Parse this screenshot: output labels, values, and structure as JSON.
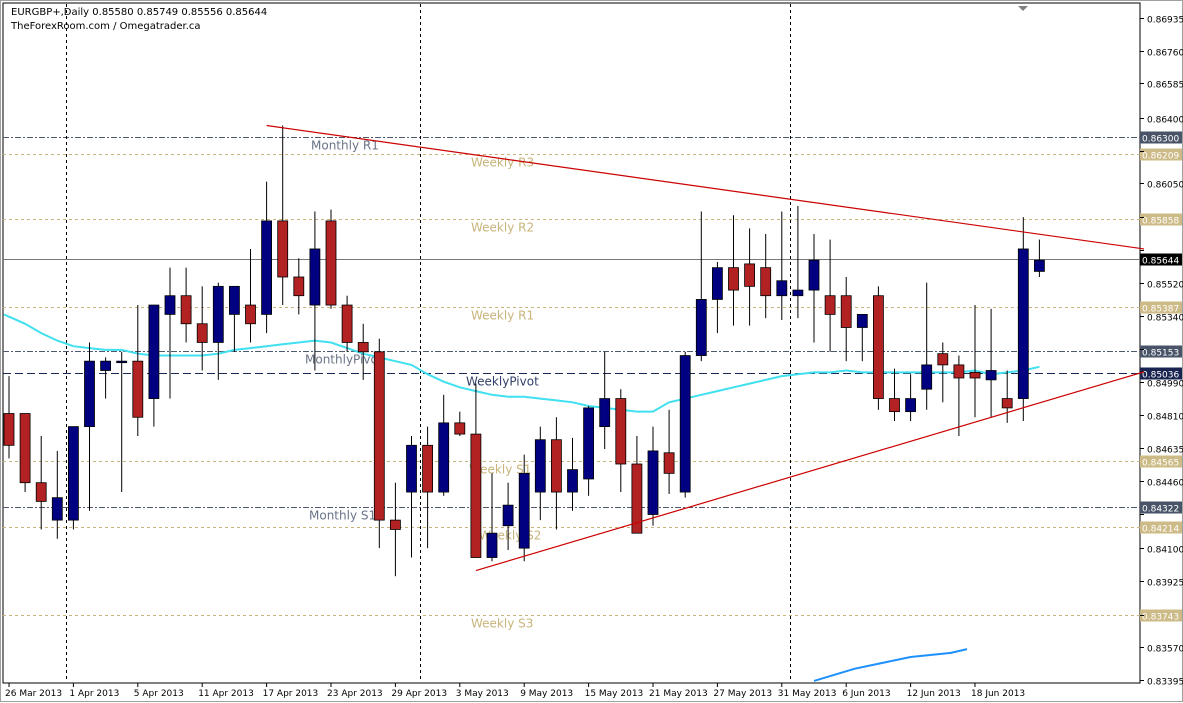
{
  "header": {
    "symbol_timeframe": "EURGBP+,Daily",
    "ohlc": "0.85580 0.85749 0.85556 0.85644",
    "credit": "TheForexRoom.com / Omegatrader.ca"
  },
  "colors": {
    "background": "#ffffff",
    "bull_candle": "#000080",
    "bear_candle": "#b22222",
    "moving_average": "#40e0f0",
    "trendline": "#cc0000",
    "lower_indicator": "#1e90ff",
    "monthly_level": "#505a6e",
    "weekly_level": "#c8b47a",
    "price_box": "#000000"
  },
  "chart_data": {
    "type": "candlestick",
    "symbol": "EURGBP+",
    "timeframe": "Daily",
    "ylim": [
      0.83395,
      0.86935
    ],
    "y_ticks": [
      "0.86935",
      "0.86760",
      "0.86585",
      "0.86400",
      "0.86225",
      "0.86050",
      "0.85870",
      "0.85695",
      "0.85520",
      "0.85340",
      "0.85165",
      "0.84990",
      "0.84810",
      "0.84635",
      "0.84460",
      "0.84280",
      "0.84100",
      "0.83925",
      "0.83745",
      "0.83570",
      "0.83395"
    ],
    "x_labels": [
      "26 Mar 2013",
      "1 Apr 2013",
      "5 Apr 2013",
      "11 Apr 2013",
      "17 Apr 2013",
      "23 Apr 2013",
      "29 Apr 2013",
      "3 May 2013",
      "9 May 2013",
      "15 May 2013",
      "21 May 2013",
      "27 May 2013",
      "31 May 2013",
      "6 Jun 2013",
      "12 Jun 2013",
      "18 Jun 2013"
    ],
    "x_label_bars": [
      0,
      4,
      8,
      12,
      16,
      20,
      24,
      28,
      32,
      36,
      40,
      44,
      48,
      52,
      56,
      60
    ],
    "period_separators_after_bars": [
      3,
      25,
      48
    ],
    "candles": [
      [
        0.8482,
        0.8502,
        0.8458,
        0.8465
      ],
      [
        0.8482,
        0.8482,
        0.844,
        0.8445
      ],
      [
        0.8445,
        0.847,
        0.842,
        0.8435
      ],
      [
        0.8425,
        0.8462,
        0.8415,
        0.8437
      ],
      [
        0.8425,
        0.8465,
        0.842,
        0.8475
      ],
      [
        0.8475,
        0.852,
        0.843,
        0.851
      ],
      [
        0.8505,
        0.8512,
        0.849,
        0.851
      ],
      [
        0.851,
        0.8515,
        0.844,
        0.851
      ],
      [
        0.851,
        0.854,
        0.847,
        0.848
      ],
      [
        0.849,
        0.8535,
        0.8475,
        0.854
      ],
      [
        0.8535,
        0.856,
        0.849,
        0.8545
      ],
      [
        0.8545,
        0.856,
        0.852,
        0.853
      ],
      [
        0.853,
        0.855,
        0.8505,
        0.852
      ],
      [
        0.852,
        0.8552,
        0.85,
        0.855
      ],
      [
        0.8535,
        0.8548,
        0.8515,
        0.855
      ],
      [
        0.854,
        0.857,
        0.852,
        0.853
      ],
      [
        0.8535,
        0.8606,
        0.8525,
        0.8585
      ],
      [
        0.8585,
        0.8636,
        0.854,
        0.8555
      ],
      [
        0.8555,
        0.8565,
        0.8535,
        0.8545
      ],
      [
        0.854,
        0.859,
        0.8505,
        0.857
      ],
      [
        0.8585,
        0.8591,
        0.8538,
        0.854
      ],
      [
        0.854,
        0.8545,
        0.8515,
        0.852
      ],
      [
        0.852,
        0.853,
        0.85,
        0.8515
      ],
      [
        0.8515,
        0.8522,
        0.841,
        0.8425
      ],
      [
        0.8425,
        0.8445,
        0.8395,
        0.842
      ],
      [
        0.844,
        0.847,
        0.8405,
        0.8465
      ],
      [
        0.8465,
        0.8475,
        0.841,
        0.844
      ],
      [
        0.844,
        0.8492,
        0.8438,
        0.8477
      ],
      [
        0.8477,
        0.8483,
        0.847,
        0.8471
      ],
      [
        0.8471,
        0.8498,
        0.8405,
        0.8405
      ],
      [
        0.8405,
        0.845,
        0.8403,
        0.8418
      ],
      [
        0.8422,
        0.8445,
        0.8409,
        0.8433
      ],
      [
        0.841,
        0.846,
        0.8403,
        0.845
      ],
      [
        0.844,
        0.8475,
        0.8425,
        0.8468
      ],
      [
        0.8468,
        0.848,
        0.842,
        0.844
      ],
      [
        0.844,
        0.8469,
        0.843,
        0.8452
      ],
      [
        0.8447,
        0.8486,
        0.8438,
        0.8485
      ],
      [
        0.8475,
        0.8515,
        0.8463,
        0.849
      ],
      [
        0.849,
        0.8495,
        0.844,
        0.8455
      ],
      [
        0.8455,
        0.847,
        0.842,
        0.8418
      ],
      [
        0.8428,
        0.8475,
        0.8422,
        0.8462
      ],
      [
        0.8461,
        0.8484,
        0.8439,
        0.845
      ],
      [
        0.844,
        0.8515,
        0.8437,
        0.8513
      ],
      [
        0.8513,
        0.859,
        0.851,
        0.8543
      ],
      [
        0.8543,
        0.8563,
        0.8525,
        0.856
      ],
      [
        0.856,
        0.8588,
        0.8529,
        0.8548
      ],
      [
        0.8562,
        0.8581,
        0.8529,
        0.855
      ],
      [
        0.856,
        0.8578,
        0.8533,
        0.8545
      ],
      [
        0.8545,
        0.859,
        0.8532,
        0.8553
      ],
      [
        0.8545,
        0.8593,
        0.8533,
        0.8548
      ],
      [
        0.8548,
        0.8578,
        0.852,
        0.8564
      ],
      [
        0.8545,
        0.8575,
        0.8515,
        0.8535
      ],
      [
        0.8545,
        0.8555,
        0.851,
        0.8528
      ],
      [
        0.8528,
        0.853,
        0.851,
        0.8535
      ],
      [
        0.8545,
        0.855,
        0.8484,
        0.849
      ],
      [
        0.849,
        0.8506,
        0.8478,
        0.8483
      ],
      [
        0.8483,
        0.8503,
        0.8478,
        0.849
      ],
      [
        0.8495,
        0.8552,
        0.8484,
        0.8508
      ],
      [
        0.8514,
        0.852,
        0.8488,
        0.8508
      ],
      [
        0.8508,
        0.8513,
        0.847,
        0.8501
      ],
      [
        0.8504,
        0.854,
        0.848,
        0.8501
      ],
      [
        0.85,
        0.8538,
        0.848,
        0.8505
      ],
      [
        0.849,
        0.8505,
        0.8477,
        0.8485
      ],
      [
        0.849,
        0.8587,
        0.8478,
        0.857
      ],
      [
        0.8558,
        0.8575,
        0.8555,
        0.8564
      ]
    ],
    "moving_average": [
      0.8535,
      0.853,
      0.8525,
      0.8521,
      0.8518,
      0.8517,
      0.8516,
      0.8516,
      0.8514,
      0.8513,
      0.8513,
      0.8513,
      0.8513,
      0.8514,
      0.8516,
      0.8517,
      0.8518,
      0.8519,
      0.852,
      0.8521,
      0.852,
      0.8517,
      0.8514,
      0.8512,
      0.851,
      0.8508,
      0.8503,
      0.8499,
      0.8496,
      0.8494,
      0.8492,
      0.8491,
      0.8491,
      0.849,
      0.8489,
      0.8488,
      0.8486,
      0.8485,
      0.8484,
      0.8483,
      0.8483,
      0.8488,
      0.849,
      0.8492,
      0.8494,
      0.8496,
      0.8498,
      0.85,
      0.8502,
      0.8503,
      0.8504,
      0.8504,
      0.8505,
      0.8504,
      0.8504,
      0.8504,
      0.8504,
      0.8504,
      0.8504,
      0.8504,
      0.8505,
      0.8503,
      0.8504,
      0.8505,
      0.8507
    ],
    "levels": [
      {
        "label": "Monthly R1",
        "value": 0.863,
        "kind": "monthly",
        "show_label": true
      },
      {
        "label": "Weekly R3",
        "value": 0.86209,
        "kind": "weekly",
        "show_label": true
      },
      {
        "label": "Weekly R2",
        "value": 0.85858,
        "kind": "weekly",
        "show_label": true
      },
      {
        "label": "Weekly R1",
        "value": 0.85387,
        "kind": "weekly",
        "show_label": true
      },
      {
        "label": "MonthlyPivot",
        "value": 0.85153,
        "kind": "monthly",
        "show_label": true
      },
      {
        "label": "WeeklyPivot",
        "value": 0.85036,
        "kind": "weekly-pivot",
        "show_label": true
      },
      {
        "label": "Weekly S1",
        "value": 0.84565,
        "kind": "weekly",
        "show_label": true
      },
      {
        "label": "Monthly S1",
        "value": 0.84322,
        "kind": "monthly",
        "show_label": true
      },
      {
        "label": "Weekly S2",
        "value": 0.84214,
        "kind": "weekly",
        "show_label": true
      },
      {
        "label": "Weekly S3",
        "value": 0.83743,
        "kind": "weekly",
        "show_label": true
      }
    ],
    "current_price": "0.85644",
    "current_price_value": 0.85644,
    "trendlines": [
      {
        "name": "upper",
        "from": {
          "bar": 16,
          "price": 0.8636
        },
        "to": {
          "bar": 70.5,
          "price": 0.857
        }
      },
      {
        "name": "lower",
        "from": {
          "bar": 29,
          "price": 0.8398
        },
        "to": {
          "bar": 70.5,
          "price": 0.85043
        }
      }
    ],
    "lower_indicator": [
      [
        50,
        0.8339
      ],
      [
        52.5,
        0.83455
      ],
      [
        56,
        0.83518
      ],
      [
        58.5,
        0.8354
      ],
      [
        59.5,
        0.8356
      ]
    ]
  }
}
